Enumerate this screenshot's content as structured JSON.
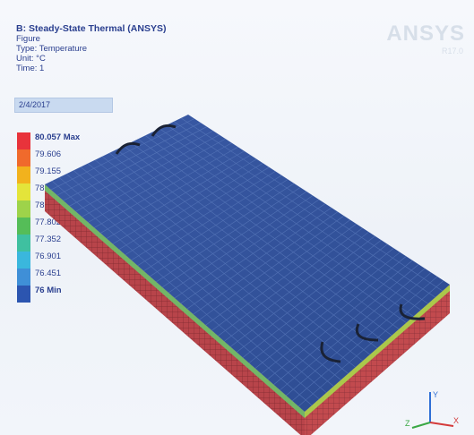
{
  "header": {
    "title": "B: Steady-State Thermal (ANSYS)",
    "line1": "Figure",
    "line2": "Type: Temperature",
    "line3": "Unit: °C",
    "line4": "Time: 1",
    "date": "2/4/2017"
  },
  "legend": {
    "items": [
      {
        "label": "80.057 Max",
        "color": "#e8333b"
      },
      {
        "label": "79.606",
        "color": "#f06a2c"
      },
      {
        "label": "79.155",
        "color": "#f2b21d"
      },
      {
        "label": "78.704",
        "color": "#e4e43a"
      },
      {
        "label": "78.253",
        "color": "#9ed34a"
      },
      {
        "label": "77.802",
        "color": "#55bd58"
      },
      {
        "label": "77.352",
        "color": "#3fc0a0"
      },
      {
        "label": "76.901",
        "color": "#3ab7dd"
      },
      {
        "label": "76.451",
        "color": "#3f8fd7"
      },
      {
        "label": "76 Min",
        "color": "#2c55b0"
      }
    ]
  },
  "logo": {
    "text": "ANSYS",
    "sub": "R17.0"
  },
  "triad": {
    "x": "X",
    "y": "Y",
    "z": "Z"
  },
  "colors": {
    "top_surface": "#2f4f98",
    "side_red": "#b8444a",
    "grid_line": "#5f7fc0",
    "ui_text": "#2a3f8f"
  }
}
